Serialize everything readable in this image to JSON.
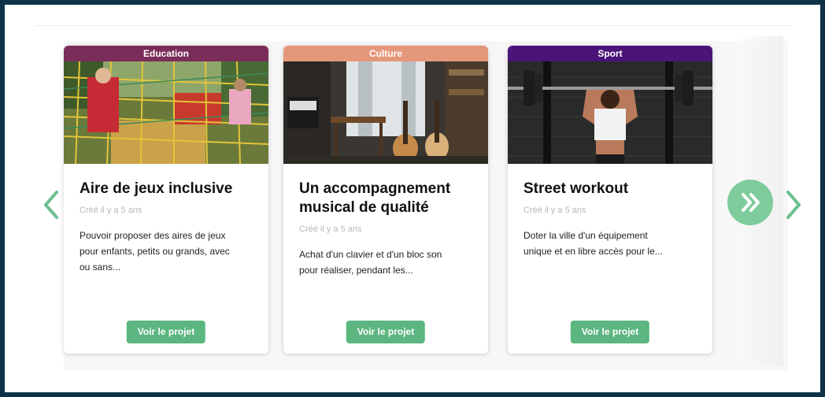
{
  "carousel": {
    "prev_icon": "chevron-left-icon",
    "next_icon": "chevron-right-icon",
    "skip_icon": "double-chevron-right-icon",
    "accent_color": "#5cb680",
    "cards": [
      {
        "category": "Education",
        "category_color": "#7b2d5a",
        "title_line1": "Aire de jeux inclusive",
        "title_line2": "",
        "date": "Créé il y a 5 ans",
        "desc_line1": "Pouvoir proposer des aires de jeux",
        "desc_line2": "pour enfants, petits ou grands, avec",
        "desc_line3": "ou sans...",
        "button": "Voir le projet"
      },
      {
        "category": "Culture",
        "category_color": "#e5977a",
        "title_line1": "Un accompagnement",
        "title_line2": "musical de qualité",
        "date": "Créé il y a 5 ans",
        "desc_line1": "Achat d'un clavier et d'un bloc son",
        "desc_line2": "pour réaliser, pendant les...",
        "desc_line3": "",
        "button": "Voir le projet"
      },
      {
        "category": "Sport",
        "category_color": "#4b1479",
        "title_line1": "Street workout",
        "title_line2": "",
        "date": "Créé il y a 5 ans",
        "desc_line1": "Doter la ville d'un équipement",
        "desc_line2": "unique et en libre accès pour le...",
        "desc_line3": "",
        "button": "Voir le projet"
      }
    ]
  }
}
